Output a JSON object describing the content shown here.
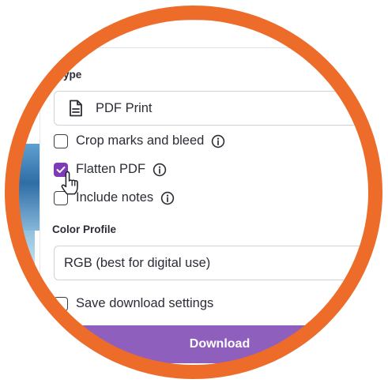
{
  "file_type": {
    "label": "ype",
    "selected": "PDF Print",
    "icon": "document-icon"
  },
  "options": [
    {
      "label": "Crop marks and bleed",
      "checked": false,
      "info": true
    },
    {
      "label": "Flatten PDF",
      "checked": true,
      "info": true
    },
    {
      "label": "Include notes",
      "checked": false,
      "info": true
    }
  ],
  "color_profile": {
    "label": "Color Profile",
    "selected": "RGB (best for digital use)"
  },
  "save_settings": {
    "label": "Save download settings",
    "checked": false
  },
  "download_button": {
    "label": "Download"
  },
  "colors": {
    "ring": "#ee6c2a",
    "accent": "#7d3cb5",
    "button": "#8e5fbd"
  }
}
